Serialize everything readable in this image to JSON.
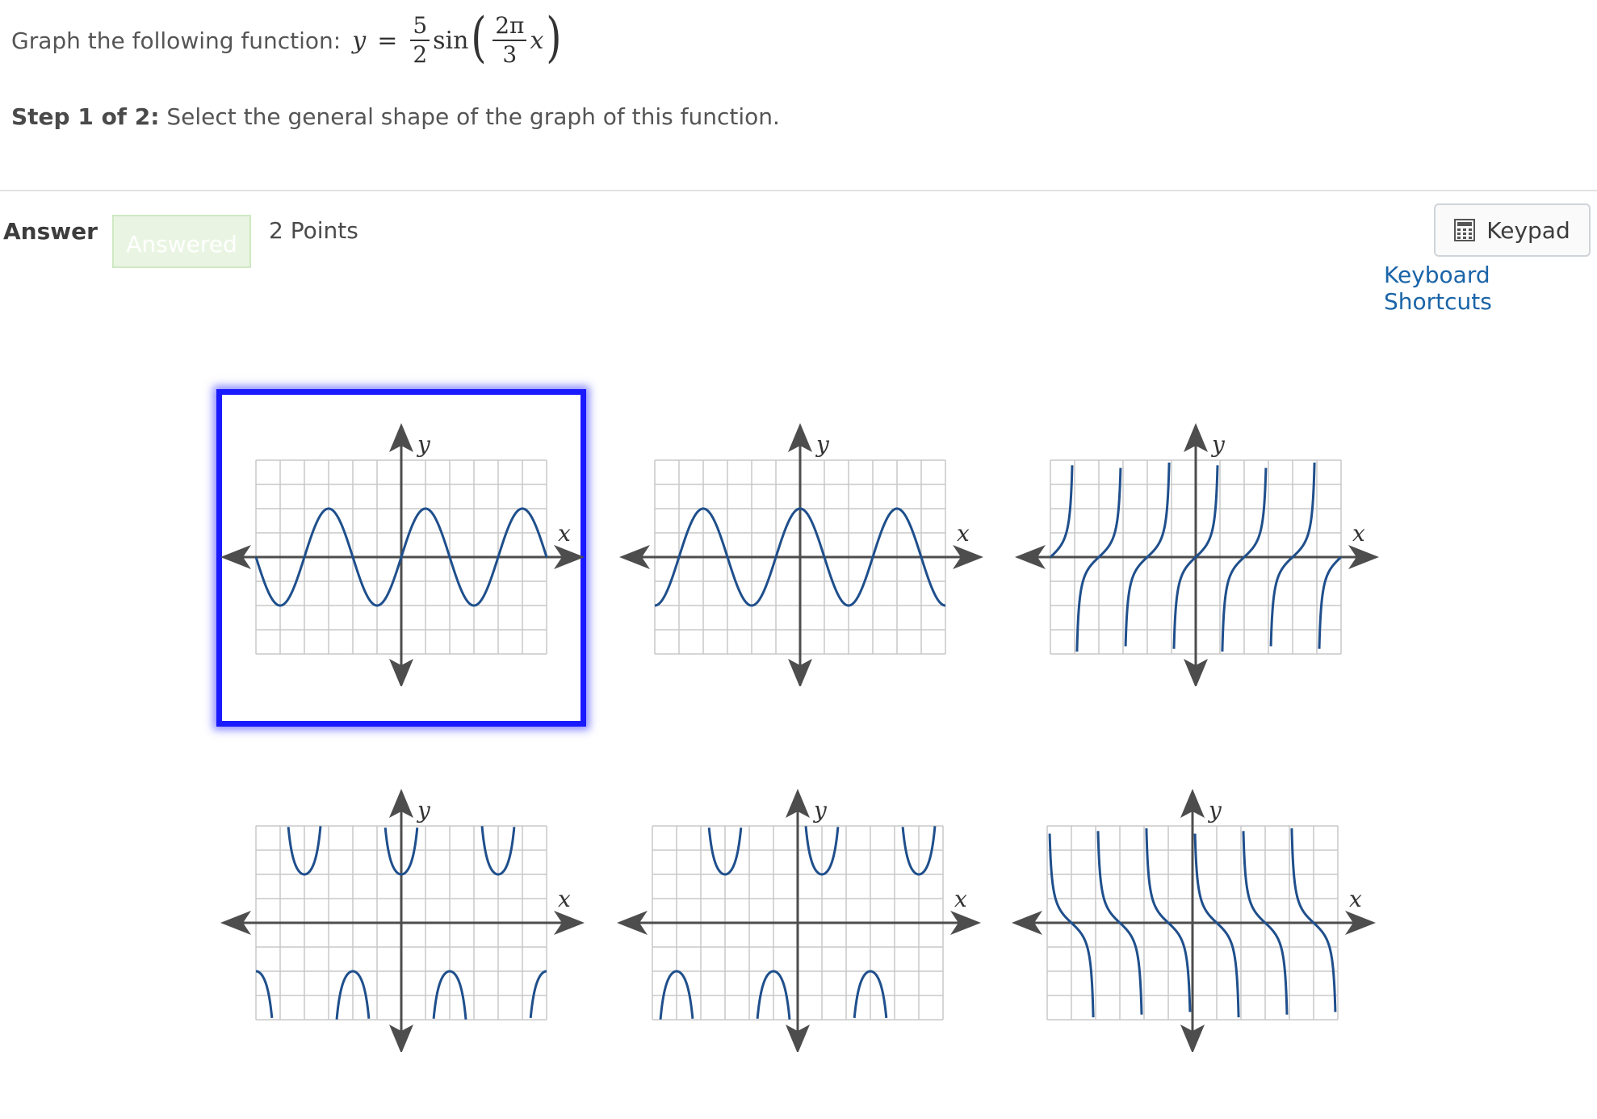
{
  "question": {
    "prefix": "Graph the following function:",
    "y_var": "y",
    "equals": "=",
    "coef_num": "5",
    "coef_den": "2",
    "func": "sin",
    "arg_num": "2π",
    "arg_den": "3",
    "x_var": "x"
  },
  "step": {
    "label": "Step 1 of 2:",
    "text": "Select the general shape of the graph of this function."
  },
  "answer": {
    "label": "Answer",
    "status": "Answered",
    "points": "2 Points"
  },
  "toolbar": {
    "keypad_label": "Keypad",
    "keypad_icon": "calculator-icon",
    "shortcuts_label": "Keyboard Shortcuts"
  },
  "colors": {
    "curve": "#1f4f8c",
    "axis": "#4d4d4d",
    "grid": "#c8c8c8",
    "selection": "#1a1aff",
    "link": "#1a64a8"
  },
  "options": [
    {
      "id": "sine",
      "curve": "sin",
      "selected": true,
      "x_label": "x",
      "y_label": "y"
    },
    {
      "id": "cosine",
      "curve": "cos",
      "selected": false,
      "x_label": "x",
      "y_label": "y"
    },
    {
      "id": "tangent",
      "curve": "tan",
      "selected": false,
      "x_label": "x",
      "y_label": "y"
    },
    {
      "id": "secant",
      "curve": "sec",
      "selected": false,
      "x_label": "x",
      "y_label": "y"
    },
    {
      "id": "cosecant",
      "curve": "csc",
      "selected": false,
      "x_label": "x",
      "y_label": "y"
    },
    {
      "id": "cotangent",
      "curve": "cot",
      "selected": false,
      "x_label": "x",
      "y_label": "y"
    }
  ]
}
